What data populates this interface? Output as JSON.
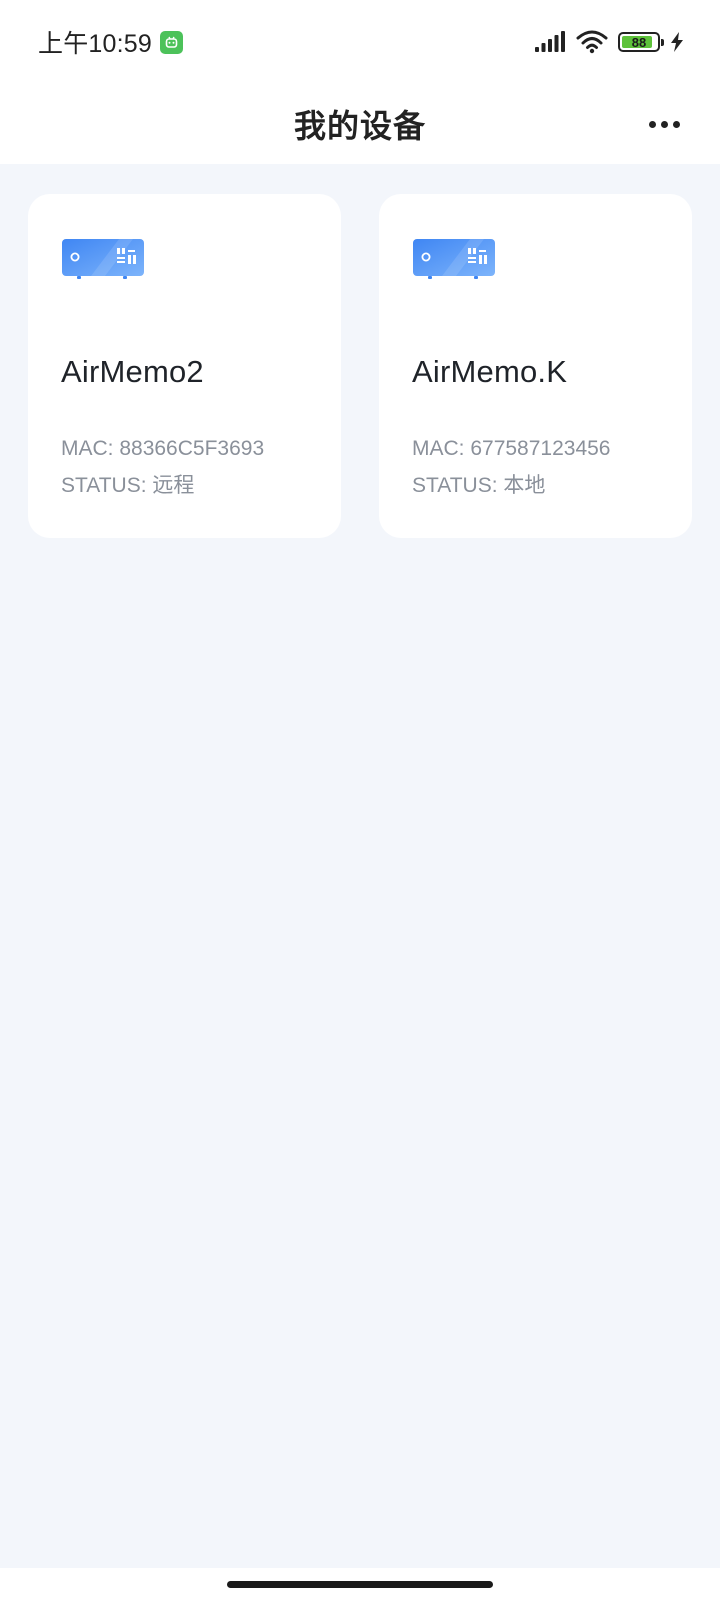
{
  "status_bar": {
    "time": "上午10:59",
    "battery_level": "88",
    "icons": [
      "app-notification-icon",
      "signal-icon",
      "wifi-icon",
      "battery-icon",
      "charging-icon"
    ]
  },
  "header": {
    "title": "我的设备",
    "more_icon": "more-horizontal-icon"
  },
  "devices": [
    {
      "name": "AirMemo2",
      "mac": "MAC: 88366C5F3693",
      "status": "STATUS: 远程",
      "icon": "device-box-icon"
    },
    {
      "name": "AirMemo.K",
      "mac": "MAC: 677587123456",
      "status": "STATUS: 本地",
      "icon": "device-box-icon"
    }
  ],
  "colors": {
    "background": "#f3f6fb",
    "card": "#ffffff",
    "device_icon_blue": "#4f8ff5",
    "secondary_text": "#8a909a"
  }
}
